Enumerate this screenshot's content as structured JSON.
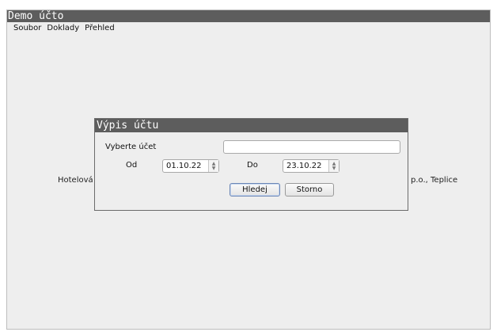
{
  "window": {
    "title": "Demo účto"
  },
  "menu": {
    "items": [
      "Soubor",
      "Doklady",
      "Přehled"
    ]
  },
  "background": {
    "left_text": "Hotelová š",
    "right_text": "p.o., Teplice"
  },
  "dialog": {
    "title": "Výpis účtu",
    "account_label": "Vyberte účet",
    "account_value": "",
    "from_label": "Od",
    "from_value": "01.10.22",
    "to_label": "Do",
    "to_value": "23.10.22",
    "search_button": "Hledej",
    "cancel_button": "Storno"
  }
}
